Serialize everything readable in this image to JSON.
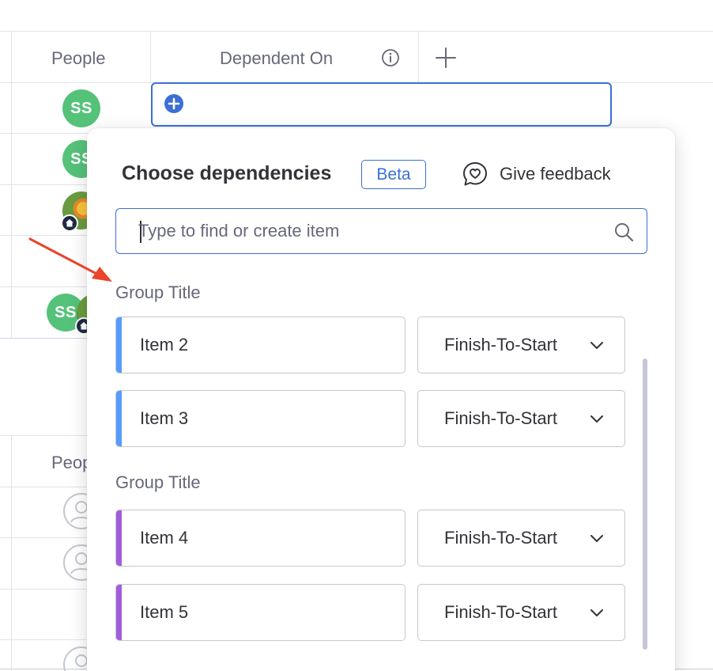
{
  "board": {
    "columns": {
      "people": "People",
      "dependent_on": "Dependent On"
    },
    "avatars": [
      {
        "initials": "SS"
      },
      {
        "initials": "SS"
      },
      {
        "initials": "SS"
      }
    ],
    "lower_group": {
      "people_header_partial": "Peop"
    }
  },
  "popover": {
    "title": "Choose dependencies",
    "badge": "Beta",
    "feedback_label": "Give feedback",
    "search": {
      "value": "",
      "placeholder": "Type to find or create item"
    },
    "groups": [
      {
        "title": "Group Title",
        "color": "#579bfc",
        "items": [
          {
            "name": "Item 2",
            "dependency_type": "Finish-To-Start"
          },
          {
            "name": "Item 3",
            "dependency_type": "Finish-To-Start"
          }
        ]
      },
      {
        "title": "Group Title",
        "color": "#a25ddc",
        "items": [
          {
            "name": "Item 4",
            "dependency_type": "Finish-To-Start"
          },
          {
            "name": "Item 5",
            "dependency_type": "Finish-To-Start"
          }
        ]
      }
    ]
  },
  "colors": {
    "accent": "#3b6fd4",
    "avatar_green": "#55c27a",
    "annotation_arrow": "#e8452c"
  }
}
